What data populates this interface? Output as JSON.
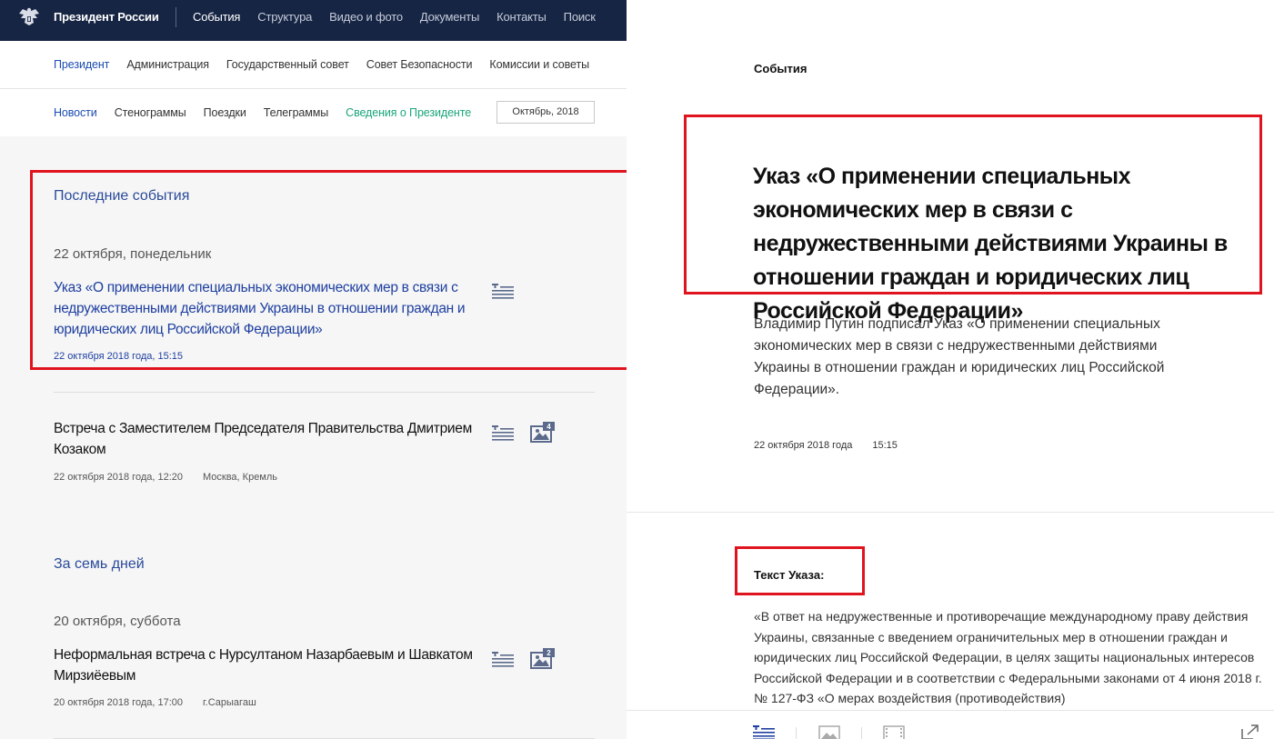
{
  "header": {
    "brand": "Президент России",
    "nav": [
      "События",
      "Структура",
      "Видео и фото",
      "Документы",
      "Контакты",
      "Поиск"
    ],
    "active_nav": "События"
  },
  "subnav": {
    "items": [
      "Президент",
      "Администрация",
      "Государственный совет",
      "Совет Безопасности",
      "Комиссии и советы"
    ]
  },
  "tabs": {
    "items": [
      "Новости",
      "Стенограммы",
      "Поездки",
      "Телеграммы",
      "Сведения о Президенте"
    ],
    "date_filter": "Октябрь, 2018"
  },
  "feed": {
    "section1": "Последние события",
    "day1": "22 октября, понедельник",
    "ev1_title": "Указ «О применении специальных экономических мер в связи с недружественными действиями Украины в отношении граждан и юридических лиц Российской Федерации»",
    "ev1_meta": "22 октября 2018 года, 15:15",
    "ev2_title": "Встреча с Заместителем Председателя Правительства Дмитрием Козаком",
    "ev2_meta": "22 октября 2018 года, 12:20",
    "ev2_place": "Москва, Кремль",
    "ev2_photos": "4",
    "section2": "За семь дней",
    "day2": "20 октября, суббота",
    "ev3_title": "Неформальная встреча с Нурсултаном Назарбаевым и Шавкатом Мирзиёевым",
    "ev3_meta": "20 октября 2018 года, 17:00",
    "ev3_place": "г.Сарыагаш",
    "ev3_photos": "2"
  },
  "article": {
    "label": "События",
    "title": "Указ «О применении специальных экономических мер в связи с недружественными действиями Украины в отношении граждан и юридических лиц Российской Федерации»",
    "lead": "Владимир Путин подписал Указ «О применении специальных экономических мер в связи с недружественными действиями Украины в отношении граждан и юридических лиц Российской Федерации».",
    "date": "22 октября 2018 года",
    "time": "15:15",
    "subheading": "Текст Указа:",
    "body": "«В ответ на недружественные и противоречащие международному праву действия Украины, связанные с введением ограничительных мер в отношении граждан и юридических лиц Российской Федерации, в целях защиты национальных интересов Российской Федерации и в соответствии с Федеральными законами от 4 июня 2018 г. № 127-ФЗ «О мерах воздействия (противодействия)"
  },
  "colors": {
    "header_bg": "#172544",
    "link": "#1f40a0",
    "green": "#1aa57b",
    "highlight": "#e0141e"
  },
  "icons": [
    "eagle-logo-icon",
    "text-icon",
    "photo-icon",
    "share-icon"
  ]
}
